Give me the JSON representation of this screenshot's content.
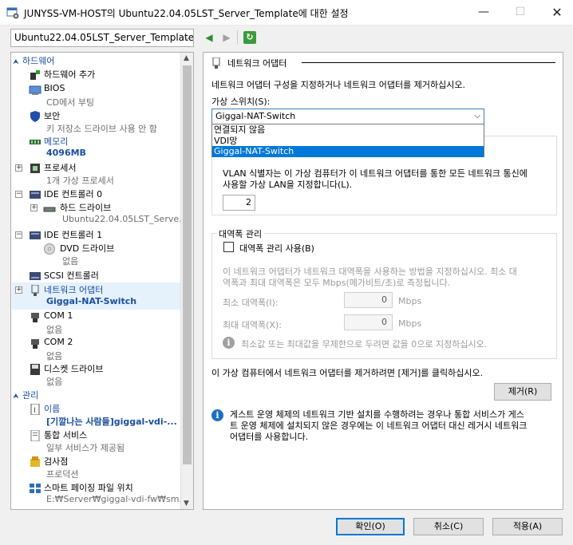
{
  "window": {
    "title": "JUNYSS-VM-HOST의 Ubuntu22.04.05LST_Server_Template에 대한 설정",
    "minimize": "—",
    "maximize": "☐",
    "close": "✕"
  },
  "vm_select": {
    "value": "Ubuntu22.04.05LST_Server_Template",
    "arrow": "⌵"
  },
  "nav": {
    "back": "◀",
    "forward": "▶",
    "refresh": "↻"
  },
  "tree": {
    "hardware_section": "하드웨어",
    "management_section": "관리",
    "items": [
      {
        "t1": "하드웨어 추가",
        "t2": ""
      },
      {
        "t1": "BIOS",
        "t2": "CD에서 부팅"
      },
      {
        "t1": "보안",
        "t2": "키 저장소 드라이브 사용 안 함"
      },
      {
        "t1": "메모리",
        "t2": "4096MB"
      },
      {
        "t1": "프로세서",
        "t2": "1개 가상 프로세서"
      },
      {
        "t1": "IDE 컨트롤러 0",
        "t2": ""
      },
      {
        "t1": "하드 드라이브",
        "t2": "Ubuntu22.04.05LST_Serve..."
      },
      {
        "t1": "IDE 컨트롤러 1",
        "t2": ""
      },
      {
        "t1": "DVD 드라이브",
        "t2": "없음"
      },
      {
        "t1": "SCSI 컨트롤러",
        "t2": ""
      },
      {
        "t1": "네트워크 어댑터",
        "t2": "Giggal-NAT-Switch"
      },
      {
        "t1": "COM 1",
        "t2": "없음"
      },
      {
        "t1": "COM 2",
        "t2": "없음"
      },
      {
        "t1": "디스켓 드라이브",
        "t2": "없음"
      },
      {
        "t1": "이름",
        "t2": "[기깔나는 사람들]giggal-vdi-..."
      },
      {
        "t1": "통합 서비스",
        "t2": "일부 서비스가 제공됨"
      },
      {
        "t1": "검사점",
        "t2": "프로덕션"
      },
      {
        "t1": "스마트 페이징 파일 위치",
        "t2": "E:₩Server₩giggal-vdi-fw₩sm..."
      }
    ]
  },
  "panel": {
    "heading": "네트워크 어댑터",
    "description": "네트워크 어댑터 구성을 지정하거나 네트워크 어댑터를 제거하십시오.",
    "switch_label": "가상 스위치(S):",
    "switch_value": "Giggal-NAT-Switch",
    "switch_options": [
      "연결되지 않음",
      "VDI망",
      "Giggal-NAT-Switch"
    ],
    "vlan_text_1": "VLAN 식별자는 이 가상 컴퓨터가 이 네트워크 어댑터를 통한 모든 네트워크 통신에",
    "vlan_text_2": "사용할 가상 LAN을 지정합니다(L).",
    "vlan_value": "2",
    "bw_group": "대역폭 관리",
    "bw_checkbox": "대역폭 관리 사용(B)",
    "bw_desc_1": "이 네트워크 어댑터가 네트워크 대역폭을 사용하는 방법을 지정하십시오. 최소 대",
    "bw_desc_2": "역폭과 최대 대역폭은 모두 Mbps(메가비트/초)로 측정됩니다.",
    "min_label": "최소 대역폭(I):",
    "min_value": "0",
    "max_label": "최대 대역폭(X):",
    "max_value": "0",
    "unit": "Mbps",
    "bw_info": "최소값 또는 최대값을 무제한으로 두려면 값을 0으로 지정하십시오.",
    "remove_text": "이 가상 컴퓨터에서 네트워크 어댑터를 제거하려면 [제거]를 클릭하십시오.",
    "remove_button": "제거(R)",
    "guest_info_1": "게스트 운영 체제의 네트워크 기반 설치를 수행하려는 경우나 통합 서비스가 게스",
    "guest_info_2": "트 운영 체제에 설치되지 않은 경우에는 이 네트워크 어댑터 대신 레거시 네트워크",
    "guest_info_3": "어댑터를 사용합니다."
  },
  "buttons": {
    "ok": "확인(O)",
    "cancel": "취소(C)",
    "apply": "적용(A)"
  },
  "colors": {
    "accent": "#0078d7",
    "tree_blue": "#1a4e9e",
    "info_blue": "#1e6fc2",
    "info_gray": "#a0a0a0"
  }
}
